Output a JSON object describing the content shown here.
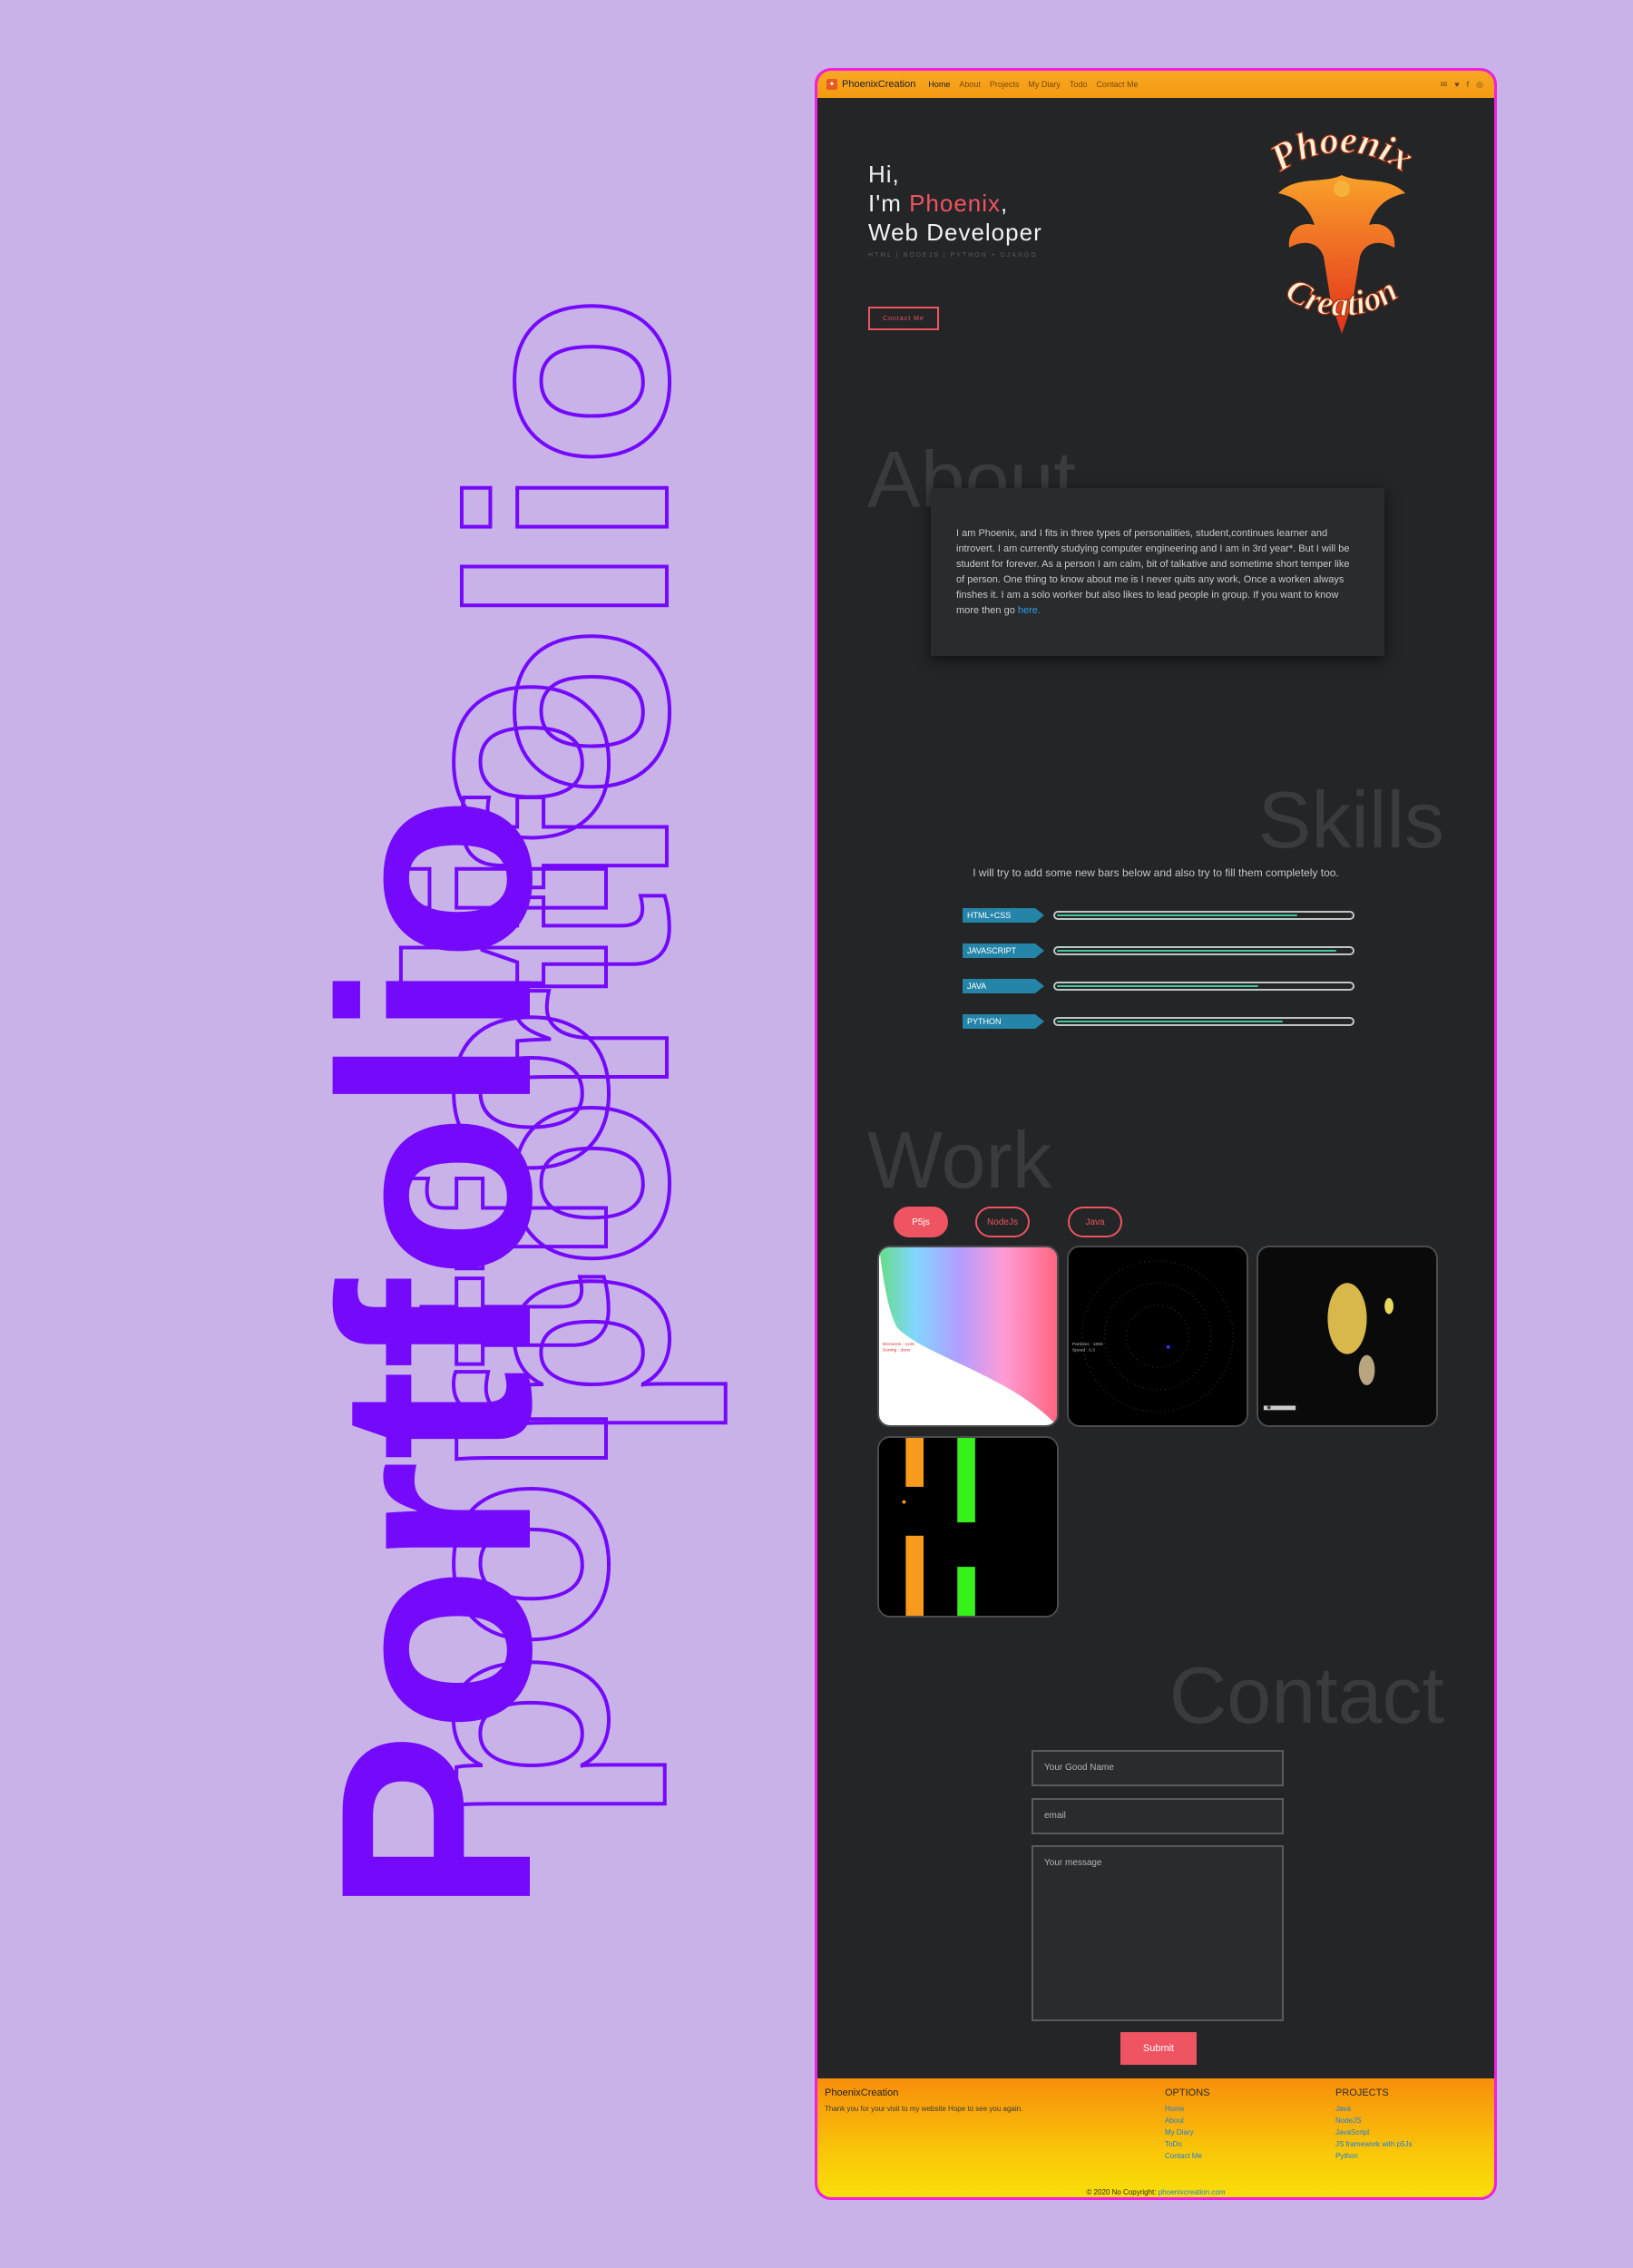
{
  "background_words": {
    "solid": "Portfolio",
    "outline_1": "portfolio",
    "outline_2": "portfolio"
  },
  "nav": {
    "brand": "PhoenixCreation",
    "links": [
      "Home",
      "About",
      "Projects",
      "My Diary",
      "Todo",
      "Contact Me"
    ],
    "active": "Home",
    "social_icons": [
      "mail-icon",
      "twitter-icon",
      "facebook-icon",
      "instagram-icon"
    ]
  },
  "hero": {
    "line1": "Hi,",
    "line2_prefix": "I'm ",
    "name": "Phoenix",
    "line2_suffix": ",",
    "line3": "Web Developer",
    "tags": "HTML | NODEJS | PYTHON + DJANGO",
    "cta": "Contact Me",
    "logo_top": "Phoenix",
    "logo_bottom": "Creation"
  },
  "about": {
    "title": "About",
    "text": "I am Phoenix, and I fits in three types of personalities, student,continues learner and introvert. I am currently studying computer engineering and I am in 3rd year*. But I will be student for forever. As a person I am calm, bit of talkative and sometime short temper like of person. One thing to know about me is I never quits any work, Once a worken always finshes it. I am a solo worker but also likes to lead people in group. If you want to know more then go ",
    "link": "here."
  },
  "skills": {
    "title": "Skills",
    "intro": "I will try to add some new bars below and also try to fill them completely too.",
    "items": [
      {
        "label": "HTML+CSS",
        "percent": 82
      },
      {
        "label": "JAVASCRIPT",
        "percent": 95
      },
      {
        "label": "JAVA",
        "percent": 69
      },
      {
        "label": "PYTHON",
        "percent": 77
      }
    ],
    "colors": {
      "tag": "#2585a8",
      "fill": "#40c79a"
    }
  },
  "work": {
    "title": "Work",
    "tabs": [
      "P5js",
      "NodeJs",
      "Java"
    ],
    "active_tab": "P5js",
    "thumbnails": [
      "p5-sorting-visualizer",
      "p5-starfield",
      "p5-solar-system",
      "p5-flappy-game"
    ]
  },
  "contact": {
    "title": "Contact",
    "name_placeholder": "Your Good Name",
    "email_placeholder": "email",
    "message_placeholder": "Your message",
    "submit": "Submit"
  },
  "footer": {
    "brand": "PhoenixCreation",
    "thanks": "Thank you for your visit to my website Hope to see you again.",
    "options_title": "OPTIONS",
    "options": [
      "Home",
      "About",
      "My Diary",
      "ToDo",
      "Contact Me"
    ],
    "projects_title": "PROJECTS",
    "projects": [
      "Java",
      "NodeJS",
      "JavaScript",
      "JS framework with p5Js",
      "Python"
    ],
    "copyright": "© 2020 No Copyright:",
    "copyright_link": "phoenixcreation.com"
  },
  "colors": {
    "accent": "#ee5461",
    "page_bg": "#c8b2e8",
    "violet": "#7409fb",
    "frame_border": "#f31ee0"
  }
}
